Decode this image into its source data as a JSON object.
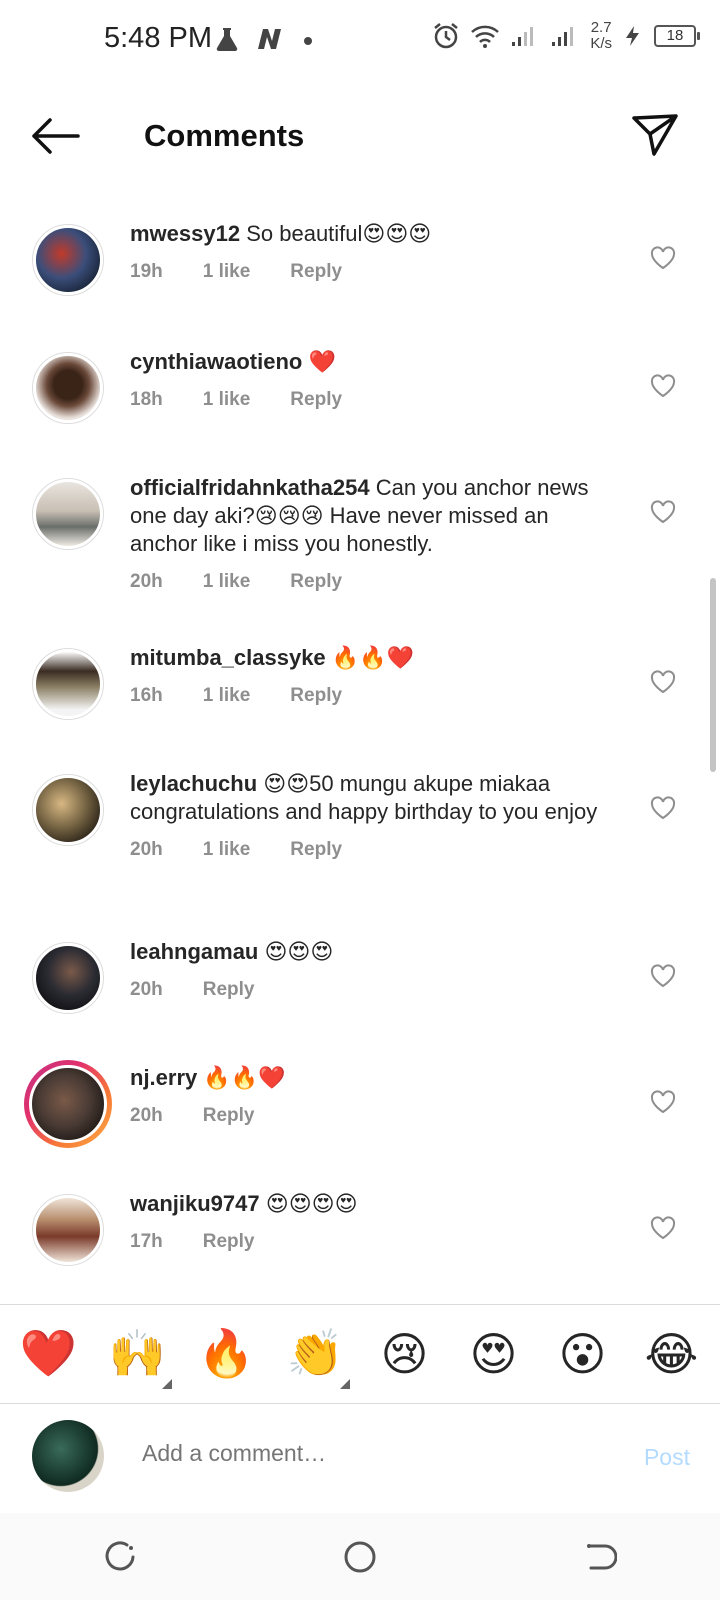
{
  "status_bar": {
    "time": "5:48 PM",
    "net_speed_value": "2.7",
    "net_speed_unit": "K/s",
    "battery": "18"
  },
  "header": {
    "title": "Comments"
  },
  "comments": [
    {
      "username": "mwessy12",
      "text": "So beautiful😍😍😍",
      "time": "19h",
      "likes": "1 like",
      "reply": "Reply",
      "avatar_color": "#3b4e7a"
    },
    {
      "username": "cynthiawaotieno",
      "text": "❤️",
      "time": "18h",
      "likes": "1 like",
      "reply": "Reply",
      "avatar_color": "#6b4a3a"
    },
    {
      "username": "officialfridahnkatha254",
      "text": "Can you anchor news one day aki?😢😢😢 Have never missed an anchor like i miss you honestly.",
      "time": "20h",
      "likes": "1 like",
      "reply": "Reply",
      "avatar_color": "#c9c0b5"
    },
    {
      "username": "mitumba_classyke",
      "text": "🔥🔥❤️",
      "time": "16h",
      "likes": "1 like",
      "reply": "Reply",
      "avatar_color": "#8c8066"
    },
    {
      "username": "leylachuchu",
      "text": "😍😍50 mungu akupe miakaa congratulations and happy birthday to you enjoy",
      "time": "20h",
      "likes": "1 like",
      "reply": "Reply",
      "avatar_color": "#6a5a3c"
    },
    {
      "username": "leahngamau",
      "text": "😍😍😍",
      "time": "20h",
      "likes": "",
      "reply": "Reply",
      "avatar_color": "#2b2b33"
    },
    {
      "username": "nj.erry",
      "text": "🔥🔥❤️",
      "time": "20h",
      "likes": "",
      "reply": "Reply",
      "avatar_color": "#4a3b35"
    },
    {
      "username": "wanjiku9747",
      "text": "😍😍😍😍",
      "time": "17h",
      "likes": "",
      "reply": "Reply",
      "avatar_color": "#b58a6a"
    }
  ],
  "emoji_bar": [
    "❤️",
    "🙌",
    "🔥",
    "👏",
    "😢",
    "😍",
    "😮",
    "😂"
  ],
  "composer": {
    "placeholder": "Add a comment…",
    "post_label": "Post"
  },
  "colors": {
    "link_blue_disabled": "#b3dbff",
    "meta_gray": "#8e8e8e",
    "story_ring_start": "#c13584",
    "story_ring_end": "#fcaf45"
  }
}
